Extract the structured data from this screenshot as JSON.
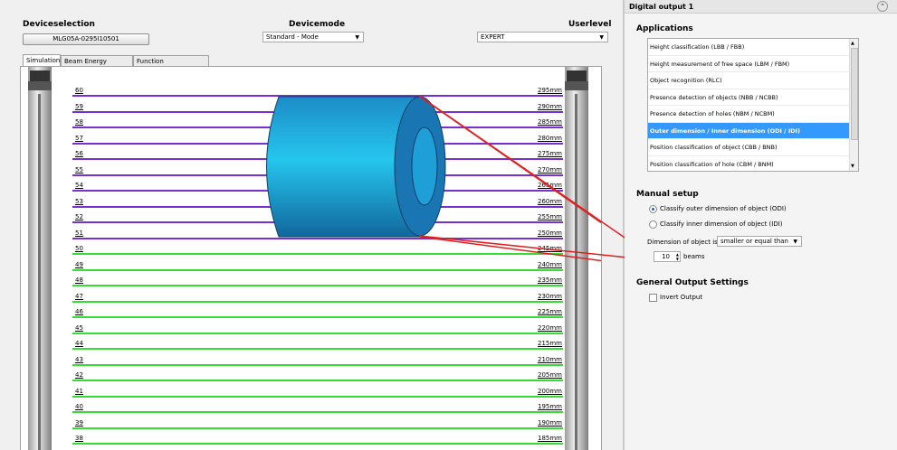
{
  "left_panel": {
    "device_selection_label": "Deviceselection",
    "device_selection_button": "MLG05A-0295I10501",
    "device_mode_label": "Devicemode",
    "device_mode_value": "Standard - Mode",
    "user_level_label": "Userlevel",
    "user_level_value": "EXPERT",
    "tabs": [
      "Simulation",
      "Beam Energy Monitor",
      "Function programming"
    ],
    "beams": [
      {
        "num": "60",
        "mm": "295mm",
        "state": "blocked"
      },
      {
        "num": "59",
        "mm": "290mm",
        "state": "blocked"
      },
      {
        "num": "58",
        "mm": "285mm",
        "state": "blocked"
      },
      {
        "num": "57",
        "mm": "280mm",
        "state": "blocked"
      },
      {
        "num": "56",
        "mm": "275mm",
        "state": "blocked"
      },
      {
        "num": "55",
        "mm": "270mm",
        "state": "blocked"
      },
      {
        "num": "54",
        "mm": "265mm",
        "state": "blocked"
      },
      {
        "num": "53",
        "mm": "260mm",
        "state": "blocked"
      },
      {
        "num": "52",
        "mm": "255mm",
        "state": "blocked"
      },
      {
        "num": "51",
        "mm": "250mm",
        "state": "blocked"
      },
      {
        "num": "50",
        "mm": "245mm",
        "state": "free"
      },
      {
        "num": "49",
        "mm": "240mm",
        "state": "free"
      },
      {
        "num": "48",
        "mm": "235mm",
        "state": "free"
      },
      {
        "num": "47",
        "mm": "230mm",
        "state": "free"
      },
      {
        "num": "46",
        "mm": "225mm",
        "state": "free"
      },
      {
        "num": "45",
        "mm": "220mm",
        "state": "free"
      },
      {
        "num": "44",
        "mm": "215mm",
        "state": "free"
      },
      {
        "num": "43",
        "mm": "210mm",
        "state": "free"
      },
      {
        "num": "42",
        "mm": "205mm",
        "state": "free"
      },
      {
        "num": "41",
        "mm": "200mm",
        "state": "free"
      },
      {
        "num": "40",
        "mm": "195mm",
        "state": "free"
      },
      {
        "num": "39",
        "mm": "190mm",
        "state": "free"
      },
      {
        "num": "38",
        "mm": "185mm",
        "state": "free"
      },
      {
        "num": "37",
        "mm": "180mm",
        "state": "free"
      }
    ],
    "colors": {
      "blocked": "#7a2fd0",
      "free": "#33dd33",
      "object": "#1ea8d8",
      "annotation": "#e02020"
    }
  },
  "right_panel": {
    "title": "Digital output 1",
    "collapse_icon": "double-chevron-up-icon",
    "applications_label": "Applications",
    "applications": [
      "Height classification (LBB / FBB)",
      "Height measurement of free space (LBM / FBM)",
      "Object recognition (RLC)",
      "Presence detection of objects (NBB / NCBB)",
      "Presence detection of holes (NBM / NCBM)",
      "Outer dimension / Inner dimension (ODI / IDI)",
      "Position classification of object (CBB / BNB)",
      "Position classification of hole (CBM / BNM)"
    ],
    "selected_index": 5,
    "manual_setup_label": "Manual setup",
    "radio_outer": "Classify outer dimension of object (ODI)",
    "radio_inner": "Classify inner dimension of object (IDI)",
    "dimension_label": "Dimension of object is",
    "dimension_value": "smaller or equal than",
    "beams_value": "10",
    "beams_unit": "beams",
    "general_label": "General Output Settings",
    "invert_label": "Invert Output"
  }
}
